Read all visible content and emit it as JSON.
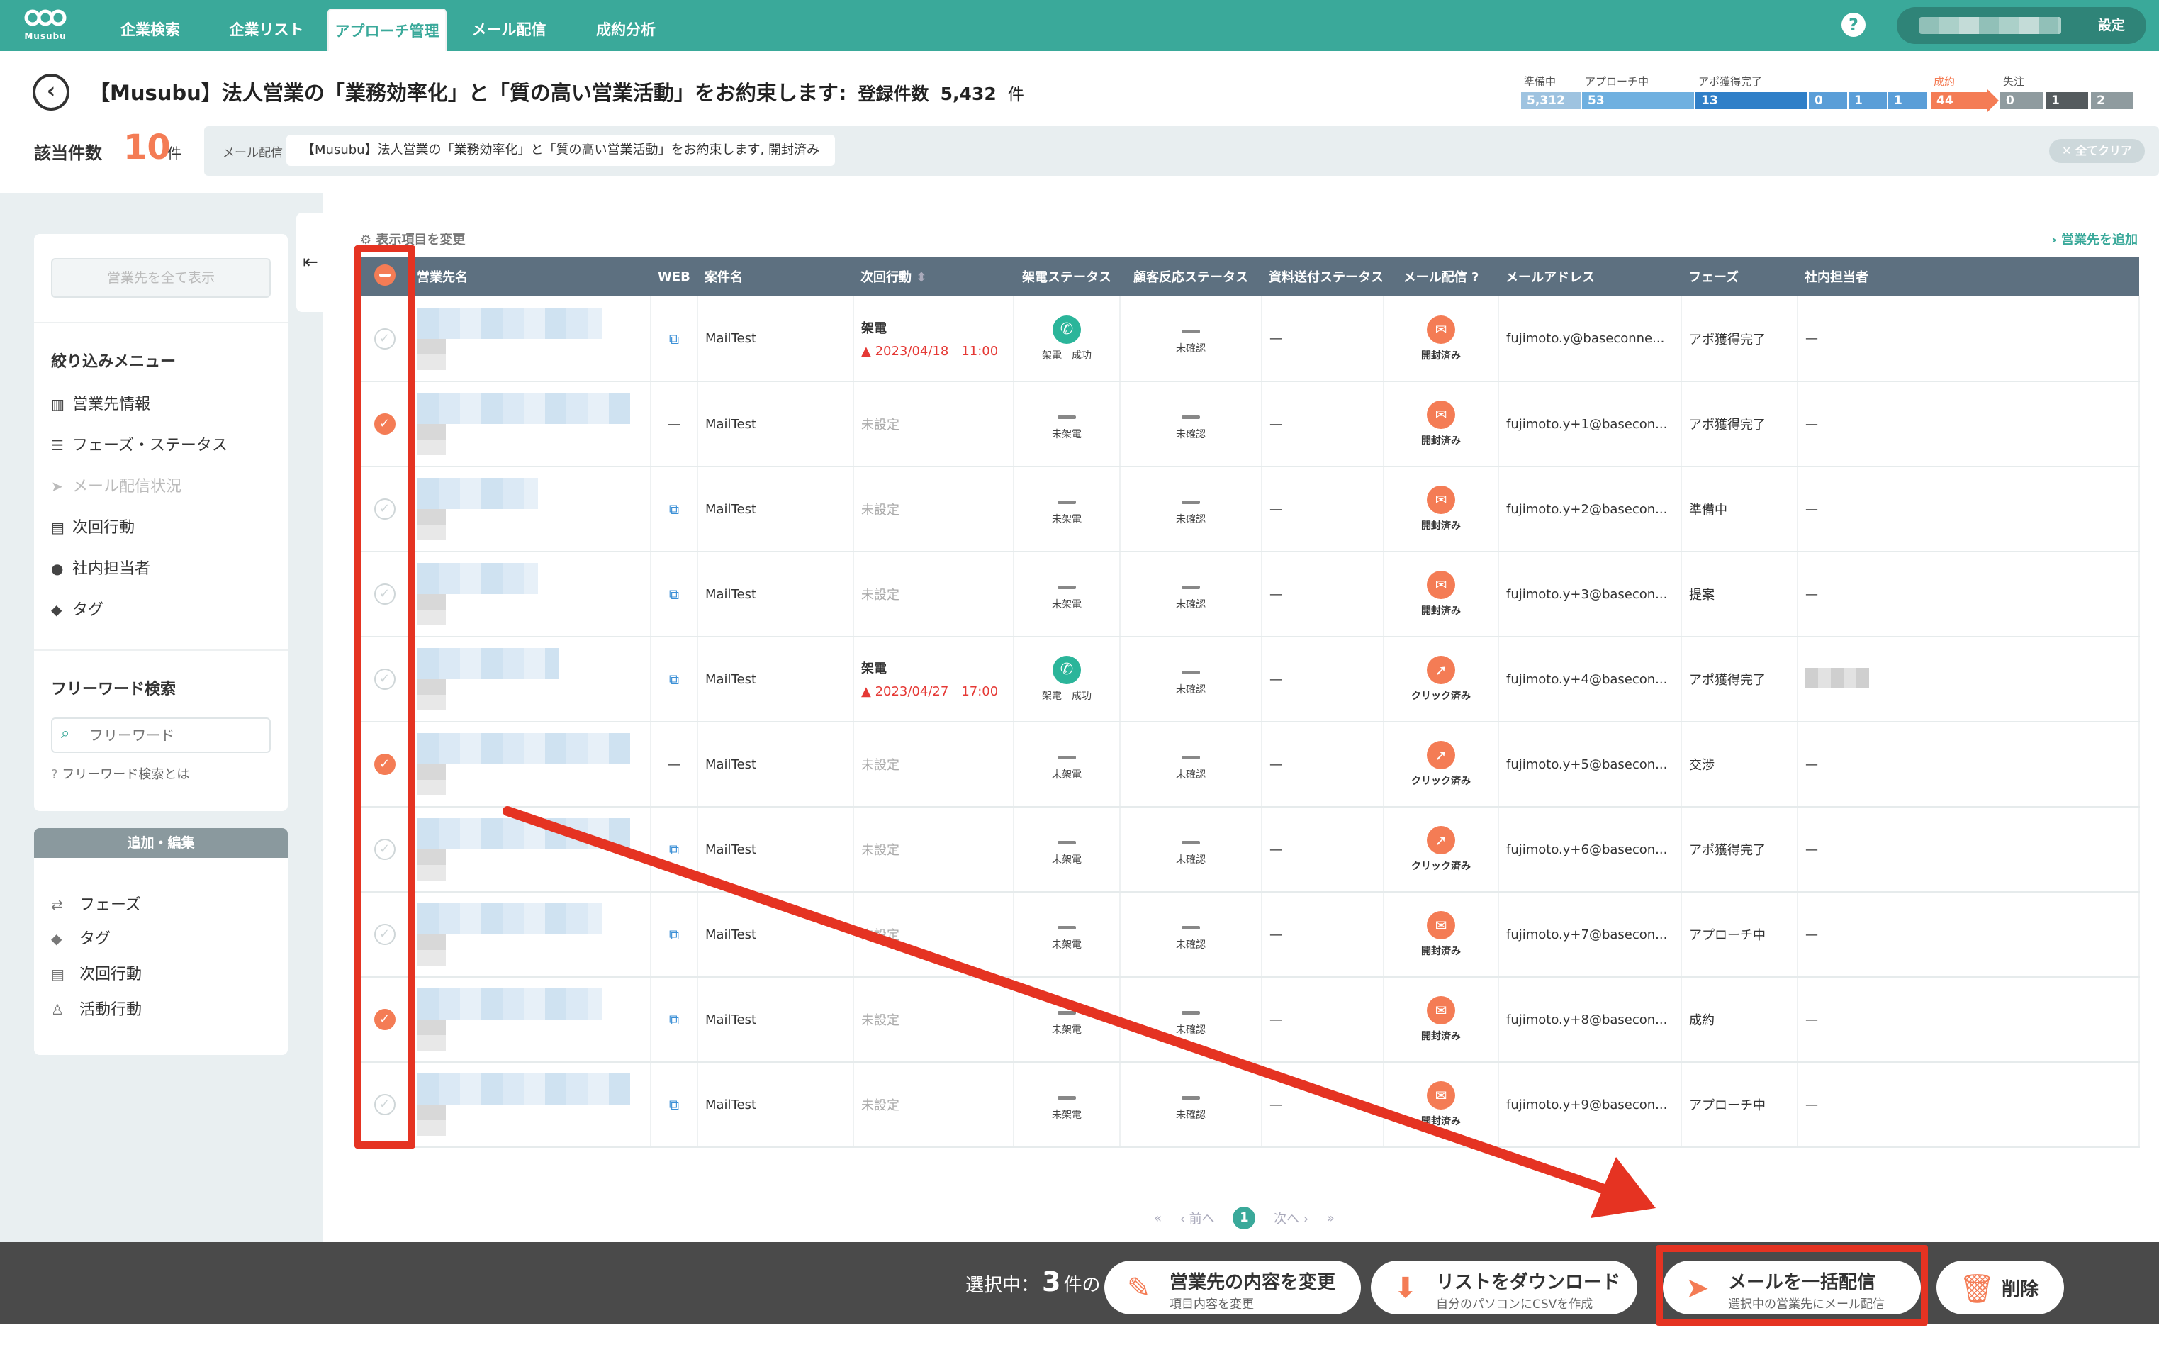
{
  "nav": {
    "logo_text": "Musubu",
    "tabs": [
      "企業検索",
      "企業リスト",
      "アプローチ管理",
      "メール配信",
      "成約分析"
    ],
    "active_tab": "アプローチ管理",
    "help_icon": "?",
    "settings_label": "設定"
  },
  "header": {
    "title": "【Musubu】法人営業の「業務効率化」と「質の高い営業活動」をお約束します:",
    "registered_label": "登録件数",
    "registered_count": "5,432",
    "registered_unit": "件"
  },
  "pipeline": [
    {
      "label": "準備中",
      "value": "5,312",
      "color": "#9ec3e0"
    },
    {
      "label": "アプローチ中",
      "value": "53",
      "color": "#6fb0e0"
    },
    {
      "label": "アポ獲得完了",
      "value": "13",
      "color": "#2f7fc8"
    },
    {
      "label": "",
      "value": "0",
      "color": "#5a9ed8"
    },
    {
      "label": "",
      "value": "1",
      "color": "#5a9ed8"
    },
    {
      "label": "",
      "value": "1",
      "color": "#5a9ed8"
    },
    {
      "label": "成約",
      "value": "44",
      "color": "#f47c55"
    },
    {
      "label": "失注",
      "value": "0",
      "color": "#8f9b9f"
    },
    {
      "label": "",
      "value": "1",
      "color": "#555b5e"
    },
    {
      "label": "",
      "value": "2",
      "color": "#8f9b9f"
    }
  ],
  "filter": {
    "count_label": "該当件数",
    "count": "10",
    "count_unit": "件",
    "chip_label": "メール配信",
    "chip_value": "【Musubu】法人営業の「業務効率化」と「質の高い営業活動」をお約束します, 開封済み",
    "clear_all": "✕ 全てクリア"
  },
  "sidebar": {
    "show_all": "営業先を全て表示",
    "menu_heading": "絞り込みメニュー",
    "menu_items": [
      {
        "icon": "building-icon",
        "label": "営業先情報",
        "disabled": false
      },
      {
        "icon": "list-icon",
        "label": "フェーズ・ステータス",
        "disabled": false
      },
      {
        "icon": "send-icon",
        "label": "メール配信状況",
        "disabled": true
      },
      {
        "icon": "calendar-icon",
        "label": "次回行動",
        "disabled": false
      },
      {
        "icon": "person-icon",
        "label": "社内担当者",
        "disabled": false
      },
      {
        "icon": "tag-icon",
        "label": "タグ",
        "disabled": false
      }
    ],
    "freeword_heading": "フリーワード検索",
    "freeword_placeholder": "フリーワード",
    "freeword_help": "フリーワード検索とは",
    "edit_heading": "追加・編集",
    "edit_items": [
      {
        "icon": "swap-icon",
        "label": "フェーズ"
      },
      {
        "icon": "tag-icon",
        "label": "タグ"
      },
      {
        "icon": "calendar-icon",
        "label": "次回行動"
      },
      {
        "icon": "walk-icon",
        "label": "活動行動"
      }
    ]
  },
  "table_tools": {
    "change_columns": "表示項目を変更",
    "add_sales": "営業先を追加"
  },
  "table": {
    "columns": [
      "営業先名",
      "WEB",
      "案件名",
      "次回行動",
      "架電ステータス",
      "顧客反応ステータス",
      "資料送付ステータス",
      "メール配信",
      "メールアドレス",
      "フェーズ",
      "社内担当者"
    ],
    "rows": [
      {
        "checked": false,
        "web": "link",
        "project": "MailTest",
        "next_action": "架電",
        "next_date": "2023/04/18　11:00",
        "call_status": "架電　成功",
        "call_ok": true,
        "reaction": "未確認",
        "doc": "—",
        "mail_icon": "envelope-open-icon",
        "mail_status": "開封済み",
        "email": "fujimoto.y@baseconne...",
        "phase": "アポ獲得完了",
        "staff": "—",
        "staff_blur": false,
        "name_w": 260
      },
      {
        "checked": true,
        "web": "—",
        "project": "MailTest",
        "next_action": "未設定",
        "next_date": "",
        "call_status": "未架電",
        "call_ok": false,
        "reaction": "未確認",
        "doc": "—",
        "mail_icon": "envelope-open-icon",
        "mail_status": "開封済み",
        "email": "fujimoto.y+1@basecon...",
        "phase": "アポ獲得完了",
        "staff": "—",
        "staff_blur": false,
        "name_w": 300
      },
      {
        "checked": false,
        "web": "link",
        "project": "MailTest",
        "next_action": "未設定",
        "next_date": "",
        "call_status": "未架電",
        "call_ok": false,
        "reaction": "未確認",
        "doc": "—",
        "mail_icon": "envelope-open-icon",
        "mail_status": "開封済み",
        "email": "fujimoto.y+2@basecon...",
        "phase": "準備中",
        "staff": "—",
        "staff_blur": false,
        "name_w": 170
      },
      {
        "checked": false,
        "web": "link",
        "project": "MailTest",
        "next_action": "未設定",
        "next_date": "",
        "call_status": "未架電",
        "call_ok": false,
        "reaction": "未確認",
        "doc": "—",
        "mail_icon": "envelope-open-icon",
        "mail_status": "開封済み",
        "email": "fujimoto.y+3@basecon...",
        "phase": "提案",
        "staff": "—",
        "staff_blur": false,
        "name_w": 170
      },
      {
        "checked": false,
        "web": "link",
        "project": "MailTest",
        "next_action": "架電",
        "next_date": "2023/04/27　17:00",
        "call_status": "架電　成功",
        "call_ok": true,
        "reaction": "未確認",
        "doc": "—",
        "mail_icon": "pointer-icon",
        "mail_status": "クリック済み",
        "email": "fujimoto.y+4@basecon...",
        "phase": "アポ獲得完了",
        "staff": "",
        "staff_blur": true,
        "name_w": 200
      },
      {
        "checked": true,
        "web": "—",
        "project": "MailTest",
        "next_action": "未設定",
        "next_date": "",
        "call_status": "未架電",
        "call_ok": false,
        "reaction": "未確認",
        "doc": "—",
        "mail_icon": "pointer-icon",
        "mail_status": "クリック済み",
        "email": "fujimoto.y+5@basecon...",
        "phase": "交渉",
        "staff": "—",
        "staff_blur": false,
        "name_w": 300
      },
      {
        "checked": false,
        "web": "link",
        "project": "MailTest",
        "next_action": "未設定",
        "next_date": "",
        "call_status": "未架電",
        "call_ok": false,
        "reaction": "未確認",
        "doc": "—",
        "mail_icon": "pointer-icon",
        "mail_status": "クリック済み",
        "email": "fujimoto.y+6@basecon...",
        "phase": "アポ獲得完了",
        "staff": "—",
        "staff_blur": false,
        "name_w": 300
      },
      {
        "checked": false,
        "web": "link",
        "project": "MailTest",
        "next_action": "未設定",
        "next_date": "",
        "call_status": "未架電",
        "call_ok": false,
        "reaction": "未確認",
        "doc": "—",
        "mail_icon": "envelope-open-icon",
        "mail_status": "開封済み",
        "email": "fujimoto.y+7@basecon...",
        "phase": "アプローチ中",
        "staff": "—",
        "staff_blur": false,
        "name_w": 260
      },
      {
        "checked": true,
        "web": "link",
        "project": "MailTest",
        "next_action": "未設定",
        "next_date": "",
        "call_status": "未架電",
        "call_ok": false,
        "reaction": "未確認",
        "doc": "—",
        "mail_icon": "envelope-open-icon",
        "mail_status": "開封済み",
        "email": "fujimoto.y+8@basecon...",
        "phase": "成約",
        "staff": "—",
        "staff_blur": false,
        "name_w": 260
      },
      {
        "checked": false,
        "web": "link",
        "project": "MailTest",
        "next_action": "未設定",
        "next_date": "",
        "call_status": "未架電",
        "call_ok": false,
        "reaction": "未確認",
        "doc": "—",
        "mail_icon": "envelope-open-icon",
        "mail_status": "開封済み",
        "email": "fujimoto.y+9@basecon...",
        "phase": "アプローチ中",
        "staff": "—",
        "staff_blur": false,
        "name_w": 300
      }
    ]
  },
  "pagination": {
    "first": "«",
    "prev": "‹ 前へ",
    "current": "1",
    "next": "次へ ›",
    "last": "»"
  },
  "action_bar": {
    "selected_prefix": "選択中：",
    "selected_count": "3",
    "selected_suffix": "件の",
    "buttons": [
      {
        "name": "edit-contents-button",
        "icon": "pencil-icon",
        "title": "営業先の内容を変更",
        "sub": "項目内容を変更"
      },
      {
        "name": "download-list-button",
        "icon": "download-icon",
        "title": "リストをダウンロード",
        "sub": "自分のパソコンにCSVを作成"
      },
      {
        "name": "bulk-mail-button",
        "icon": "paper-plane-icon",
        "title": "メールを一括配信",
        "sub": "選択中の営業先にメール配信"
      },
      {
        "name": "delete-button",
        "icon": "trash-icon",
        "title": "削除",
        "sub": ""
      }
    ]
  },
  "colors": {
    "brand": "#3aa99a",
    "accent": "#f47c55",
    "annotation": "#e53322"
  }
}
